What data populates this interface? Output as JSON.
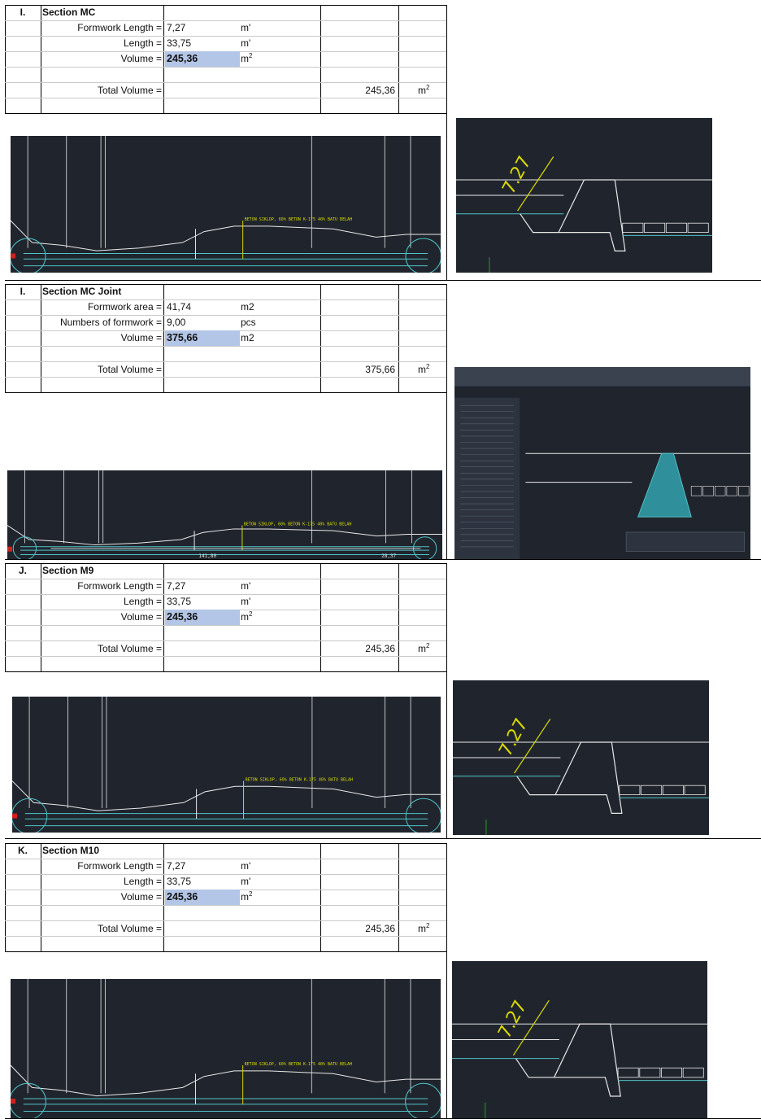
{
  "sections": [
    {
      "letter": "I.",
      "title": "Section MC",
      "rows": [
        {
          "label": "Formwork Length =",
          "value": "7,27",
          "unit": "m'",
          "sup": ""
        },
        {
          "label": "Length =",
          "value": "33,75",
          "unit": "m'",
          "sup": ""
        },
        {
          "label": "Volume =",
          "value": "245,36",
          "unit": "m",
          "sup": "2"
        }
      ],
      "total_label": "Total Volume =",
      "total_value": "245,36",
      "total_unit": "m",
      "total_sup": "2",
      "profile_text": "BETON SIKLOP, 60% BETON K-175 40% BATU BELAH",
      "detail_dimension": "7.27"
    },
    {
      "letter": "I.",
      "title": "Section MC Joint",
      "rows": [
        {
          "label": "Formwork area =",
          "value": "41,74",
          "unit": "m2",
          "sup": ""
        },
        {
          "label": "Numbers of formwork =",
          "value": "9,00",
          "unit": "pcs",
          "sup": ""
        },
        {
          "label": "Volume =",
          "value": "375,66",
          "unit": "m2",
          "sup": ""
        }
      ],
      "total_label": "Total Volume =",
      "total_value": "375,66",
      "total_unit": "m",
      "total_sup": "2",
      "profile_text": "BETON SIKLOP, 60% BETON K-175 40% BATU BELAH",
      "dim_left": "141,80",
      "dim_right": "28,37"
    },
    {
      "letter": "J.",
      "title": "Section M9",
      "rows": [
        {
          "label": "Formwork Length =",
          "value": "7,27",
          "unit": "m'",
          "sup": ""
        },
        {
          "label": "Length =",
          "value": "33,75",
          "unit": "m'",
          "sup": ""
        },
        {
          "label": "Volume =",
          "value": "245,36",
          "unit": "m",
          "sup": "2"
        }
      ],
      "total_label": "Total Volume =",
      "total_value": "245,36",
      "total_unit": "m",
      "total_sup": "2",
      "profile_text": "BETON SIKLOP, 60% BETON K-175 40% BATU BELAH",
      "detail_dimension": "7.27"
    },
    {
      "letter": "K.",
      "title": "Section M10",
      "rows": [
        {
          "label": "Formwork Length =",
          "value": "7,27",
          "unit": "m'",
          "sup": ""
        },
        {
          "label": "Length =",
          "value": "33,75",
          "unit": "m'",
          "sup": ""
        },
        {
          "label": "Volume =",
          "value": "245,36",
          "unit": "m",
          "sup": "2"
        }
      ],
      "total_label": "Total Volume =",
      "total_value": "245,36",
      "total_unit": "m",
      "total_sup": "2",
      "profile_text": "BETON SIKLOP, 60% BETON K-175 40% BATU BELAH",
      "detail_dimension": "7.27"
    }
  ],
  "colors": {
    "cad_background": "#20252d",
    "cad_line": "#e8e8e8",
    "cad_cyan": "#4fc3c8",
    "cad_yellow": "#d8d800",
    "cad_red": "#d02020",
    "highlight": "#b4c6e7"
  }
}
